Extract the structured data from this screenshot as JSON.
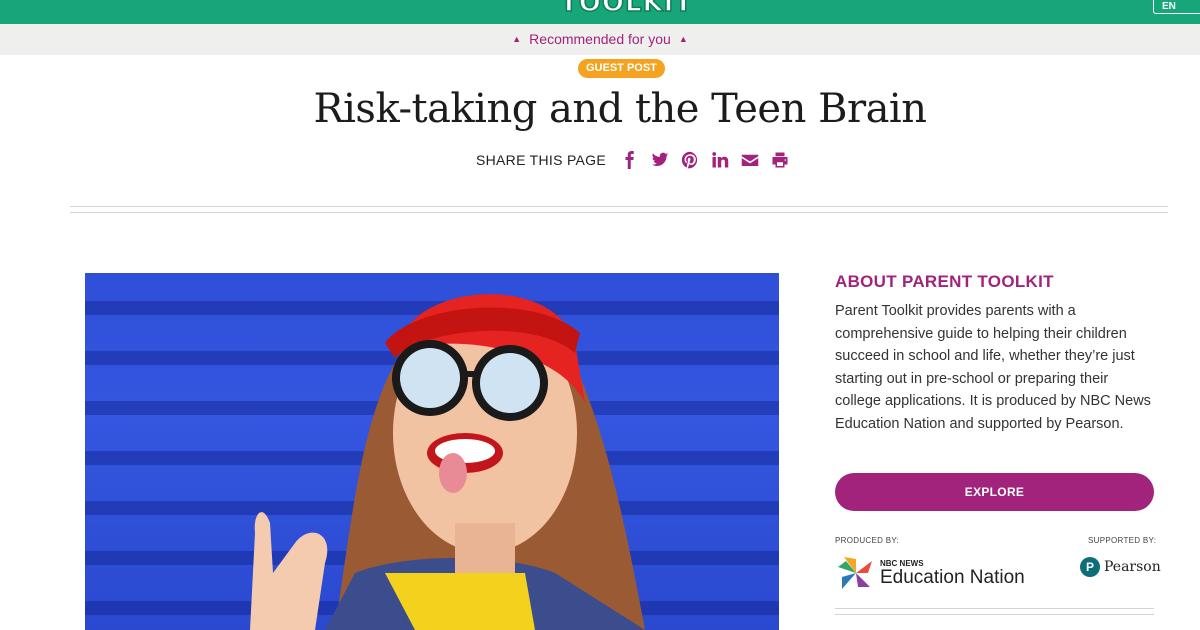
{
  "header": {
    "logo_text": "TOOLKIT",
    "right_button_label": "EN",
    "brand_color": "#17a57a"
  },
  "recommended": {
    "label": "Recommended for you",
    "icon": "caret-up-icon"
  },
  "article": {
    "badge": "GUEST POST",
    "title": "Risk-taking and the Teen Brain",
    "share_label": "SHARE THIS PAGE",
    "share_icons": [
      "facebook-icon",
      "twitter-icon",
      "pinterest-icon",
      "linkedin-icon",
      "email-icon",
      "print-icon"
    ],
    "accent_color": "#a2237c"
  },
  "sidebar": {
    "heading": "ABOUT PARENT TOOLKIT",
    "description": "Parent Toolkit provides parents with a comprehensive guide to helping their children succeed in school and life, whether they’re just starting out in pre-school or preparing their college applications. It is produced by NBC News Education Nation and supported by Pearson.",
    "explore_label": "EXPLORE",
    "produced_by_label": "PRODUCED BY:",
    "supported_by_label": "SUPPORTED BY:",
    "nbc_small": "NBC NEWS",
    "nbc_big": "Education Nation",
    "pearson_text": "Pearson",
    "pearson_mark": "P"
  }
}
